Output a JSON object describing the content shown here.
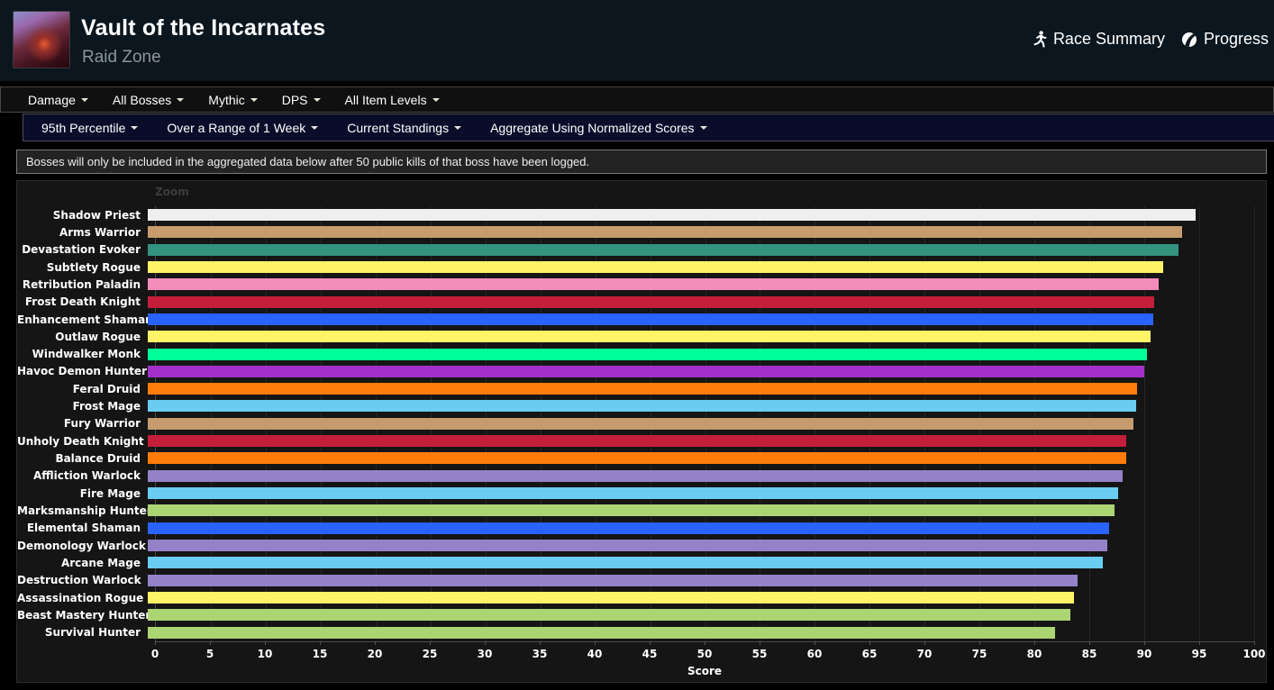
{
  "header": {
    "title": "Vault of the Incarnates",
    "subtitle": "Raid Zone",
    "links": [
      {
        "label": "Race Summary",
        "icon": "runner-icon"
      },
      {
        "label": "Progress",
        "icon": "progress-icon"
      }
    ]
  },
  "filter_bar": {
    "items": [
      {
        "label": "Damage"
      },
      {
        "label": "All Bosses"
      },
      {
        "label": "Mythic"
      },
      {
        "label": "DPS"
      },
      {
        "label": "All Item Levels"
      }
    ]
  },
  "settings_bar": {
    "items": [
      {
        "label": "95th Percentile"
      },
      {
        "label": "Over a Range of 1 Week"
      },
      {
        "label": "Current Standings"
      },
      {
        "label": "Aggregate Using Normalized Scores"
      }
    ]
  },
  "notice": "Bosses will only be included in the aggregated data below after 50 public kills of that boss have been logged.",
  "chart": {
    "zoom_label": "Zoom",
    "xlabel": "Score"
  },
  "chart_data": {
    "type": "bar",
    "orientation": "horizontal",
    "title": "",
    "xlabel": "Score",
    "xlim": [
      0,
      100
    ],
    "xticks": [
      0,
      5,
      10,
      15,
      20,
      25,
      30,
      35,
      40,
      45,
      50,
      55,
      60,
      65,
      70,
      75,
      80,
      85,
      90,
      95,
      100
    ],
    "grid": true,
    "categories": [
      "Shadow Priest",
      "Arms Warrior",
      "Devastation Evoker",
      "Subtlety Rogue",
      "Retribution Paladin",
      "Frost Death Knight",
      "Enhancement Shaman",
      "Outlaw Rogue",
      "Windwalker Monk",
      "Havoc Demon Hunter",
      "Feral Druid",
      "Frost Mage",
      "Fury Warrior",
      "Unholy Death Knight",
      "Balance Druid",
      "Affliction Warlock",
      "Fire Mage",
      "Marksmanship Hunter",
      "Elemental Shaman",
      "Demonology Warlock",
      "Arcane Mage",
      "Destruction Warlock",
      "Assassination Rogue",
      "Beast Mastery Hunter",
      "Survival Hunter"
    ],
    "values": [
      94.7,
      93.5,
      93.2,
      91.8,
      91.4,
      91.0,
      90.9,
      90.6,
      90.3,
      90.1,
      89.4,
      89.3,
      89.1,
      88.4,
      88.4,
      88.1,
      87.7,
      87.4,
      86.9,
      86.7,
      86.3,
      84.0,
      83.7,
      83.4,
      82.0
    ],
    "colors": [
      "#EFEFEF",
      "#C69B6D",
      "#33937F",
      "#FFF468",
      "#F48CBA",
      "#C41E3A",
      "#2962FF",
      "#FFF468",
      "#00FF98",
      "#A330C9",
      "#FF7C0A",
      "#69CCF0",
      "#C69B6D",
      "#C41E3A",
      "#FF7C0A",
      "#9482C9",
      "#69CCF0",
      "#ABD473",
      "#2962FF",
      "#9482C9",
      "#69CCF0",
      "#9482C9",
      "#FFF468",
      "#ABD473",
      "#ABD473"
    ]
  },
  "ui_colors": {
    "header_bg": "#0b161e",
    "settings_bar_bg": "#0a0d29",
    "chart_bg": "#151515",
    "notice_bg": "#232323"
  }
}
